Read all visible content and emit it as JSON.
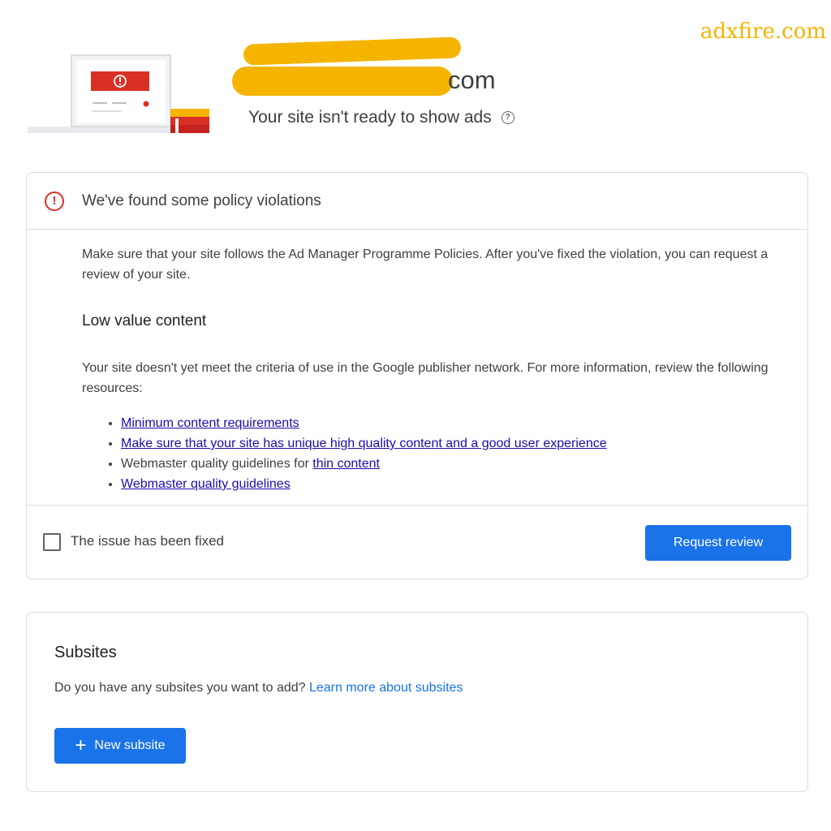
{
  "watermark": "adxfire.com",
  "header": {
    "domain_suffix": "com",
    "status_text": "Your site isn't ready to show ads",
    "help_icon": "help-circle-icon"
  },
  "policy_card": {
    "icon": "error-circle-icon",
    "title": "We've found some policy violations",
    "intro": "Make sure that your site follows the Ad Manager Programme Policies. After you've fixed the violation, you can request a review of your site.",
    "section_title": "Low value content",
    "description": "Your site doesn't yet meet the criteria of use in the Google publisher network. For more information, review the following resources:",
    "resources": {
      "item1": "Minimum content requirements",
      "item2": "Make sure that your site has unique high quality content and a good user experience",
      "item3_prefix": "Webmaster quality guidelines for ",
      "item3_link": "thin content",
      "item4": "Webmaster quality guidelines"
    },
    "checkbox_label": "The issue has been fixed",
    "checkbox_checked": false,
    "review_button": "Request review"
  },
  "subsites_card": {
    "title": "Subsites",
    "question": "Do you have any subsites you want to add?",
    "learn_more": "Learn more about subsites",
    "new_button": "New subsite",
    "new_button_icon": "plus-icon"
  },
  "colors": {
    "accent": "#1a73e8",
    "error": "#d93025",
    "redaction": "#f5b400",
    "link": "#1a0dab"
  }
}
